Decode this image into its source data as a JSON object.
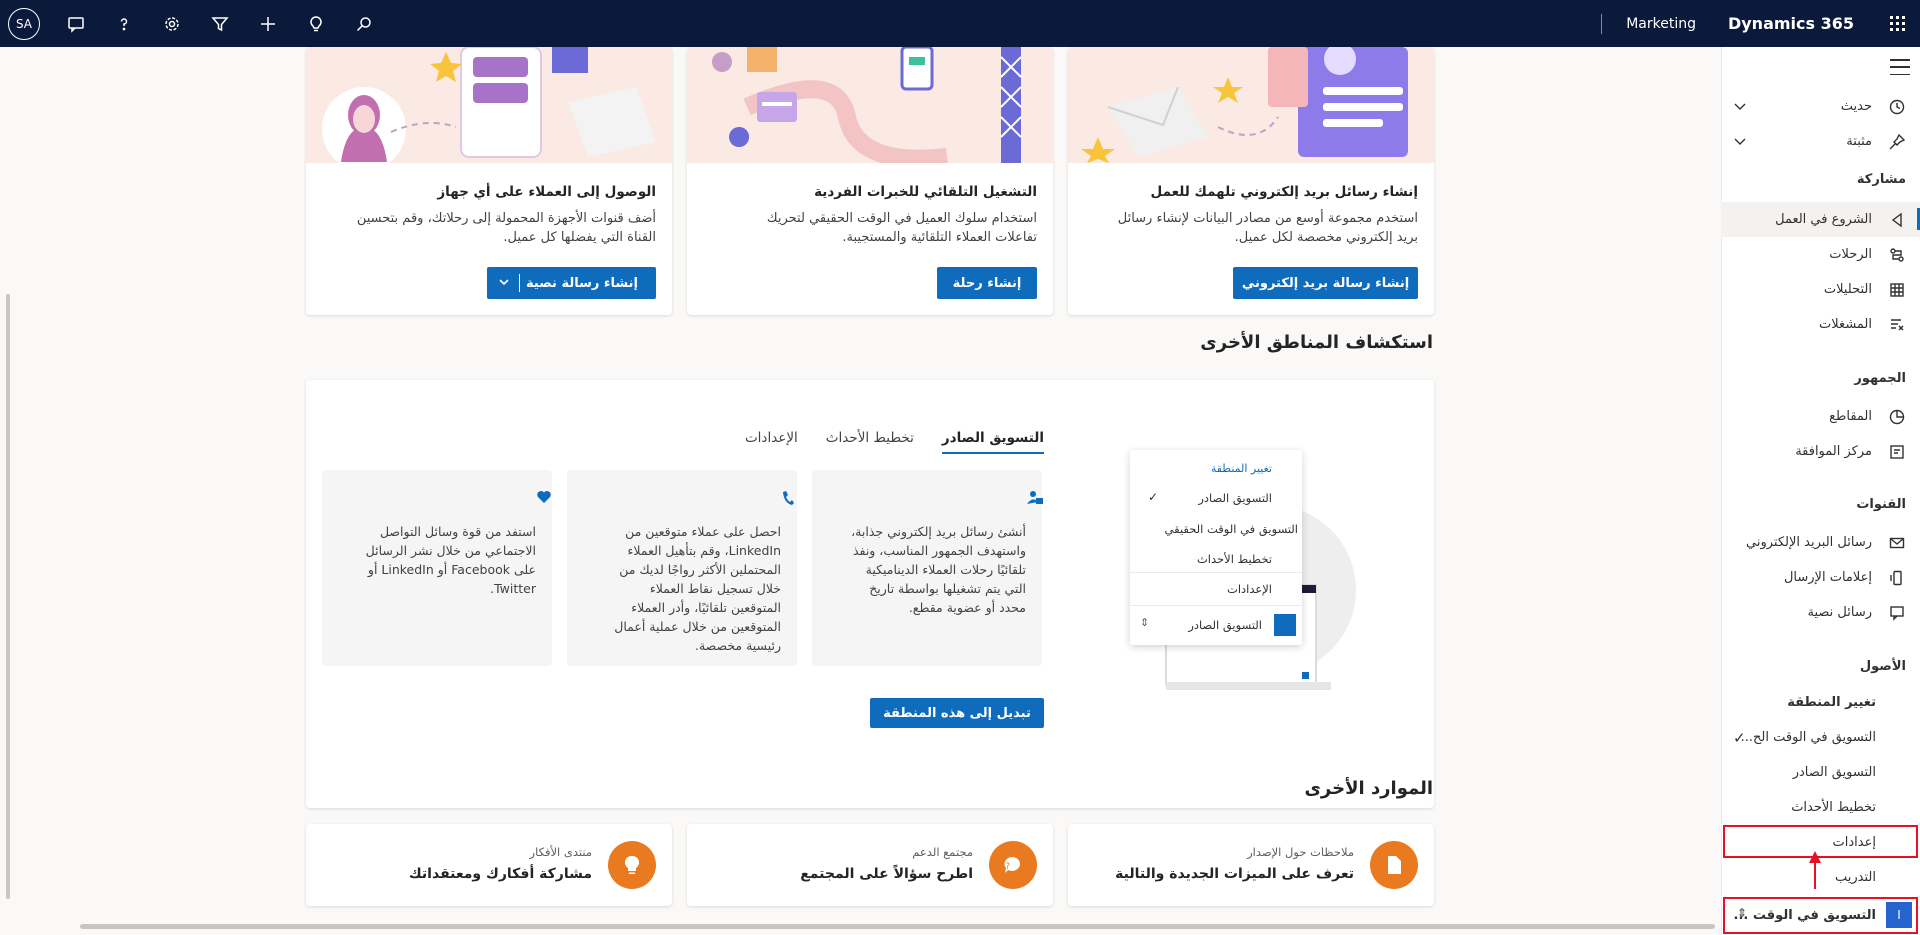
{
  "topbar": {
    "avatar_initials": "SA",
    "area_label": "Marketing",
    "product_name": "Dynamics 365",
    "icons": [
      "chat-icon",
      "help-icon",
      "settings-icon",
      "filter-icon",
      "add-icon",
      "lightbulb-icon",
      "search-icon"
    ]
  },
  "hero_cards": [
    {
      "title": "إنشاء رسائل بريد إلكتروني تلهمك للعمل",
      "desc1": "استخدم مجموعة أوسع من مصادر البيانات لإنشاء رسائل",
      "desc2": "بريد إلكتروني مخصصة لكل عميل.",
      "button": "إنشاء رسالة بريد إلكتروني"
    },
    {
      "title": "التشغيل التلقائي للخبرات الفردية",
      "desc1": "استخدام سلوك العميل في الوقت الحقيقي لتحريك",
      "desc2": "تفاعلات العملاء التلقائية والمستجيبة.",
      "button": "إنشاء رحلة"
    },
    {
      "title": "الوصول إلى العملاء على أي جهاز",
      "desc1": "أضف قنوات الأجهزة المحمولة إلى رحلاتك، وقم بتحسين",
      "desc2": "القناة التي يفضلها كل عميل.",
      "button": "إنشاء رسالة نصية"
    }
  ],
  "explore": {
    "title": "استكشاف المناطق الأخرى",
    "tabs": [
      "التسويق الصادر",
      "تخطيط الأحداث",
      "الإعدادات"
    ],
    "tiles": [
      {
        "icon": "person-mail-icon",
        "lines": [
          "أنشئ رسائل بريد إلكتروني جذابة،",
          "واستهدف الجمهور المناسب، ونفذ",
          "تلقائيًا رحلات العملاء الديناميكية",
          "التي يتم تشغيلها بواسطة تاريخ",
          "محدد أو عضوية مقطع."
        ]
      },
      {
        "icon": "phone-icon",
        "lines": [
          "احصل على عملاء متوقعين من",
          "LinkedIn، وقم بتأهيل العملاء",
          "المحتملين الأكثر رواجًا لديك من",
          "خلال تسجيل نقاط العملاء",
          "المتوقعين تلقائيًا، وأدر العملاء",
          "المتوقعين من خلال عملية أعمال",
          "رئيسية مخصصة."
        ]
      },
      {
        "icon": "heart-icon",
        "lines": [
          "استفد من قوة وسائل التواصل",
          "الاجتماعي من خلال نشر الرسائل",
          "على Facebook أو LinkedIn أو",
          "Twitter."
        ]
      }
    ],
    "button": "تبديل إلى هذه المنطقة",
    "mini_menu": {
      "header": "تغيير المنطقة",
      "items": [
        "التسويق الصادر",
        "التسويق في الوقت الحقيقي",
        "تخطيط الأحداث",
        "الإعدادات"
      ],
      "footer": "التسويق الصادر"
    }
  },
  "resources": {
    "title": "الموارد الأخرى",
    "items": [
      {
        "sub": "ملاحظات حول الإصدار",
        "title": "تعرف على الميزات الجديدة والتالية",
        "icon": "document-icon"
      },
      {
        "sub": "مجتمع الدعم",
        "title": "اطرح سؤالاً على المجتمع",
        "icon": "chat-question-icon"
      },
      {
        "sub": "منتدى الأفكار",
        "title": "مشاركة أفكارك ومعتقداتك",
        "icon": "lightbulb-icon"
      }
    ]
  },
  "sidebar": {
    "recent": "حديث",
    "pinned": "مثبتة",
    "engagement_header": "مشاركة",
    "engagement": [
      "الشروع في العمل",
      "الرحلات",
      "التحليلات",
      "المشغلات"
    ],
    "audience_header": "الجمهور",
    "audience": [
      "المقاطع",
      "مركز الموافقة"
    ],
    "channels_header": "القنوات",
    "channels": [
      "رسائل البريد الإلكتروني",
      "إعلامات الإرسال",
      "رسائل نصية"
    ],
    "assets_header": "الأصول",
    "popup": {
      "header": "تغيير المنطقة",
      "items": [
        "التسويق في الوقت الح...",
        "التسويق الصادر",
        "تخطيط الأحداث",
        "إعدادات",
        "التدريب"
      ]
    },
    "area_switch": {
      "initial": "I",
      "label": "التسويق في الوقت ..."
    }
  }
}
